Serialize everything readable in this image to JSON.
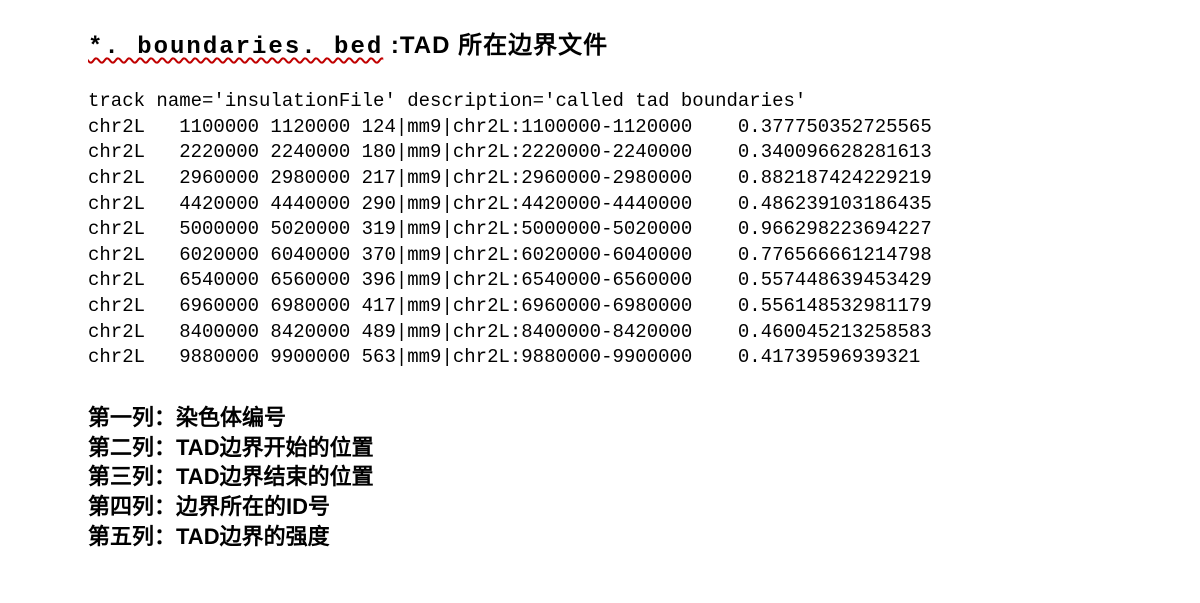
{
  "heading": {
    "filename": "*. boundaries. bed",
    "separator": " :",
    "desc": "TAD 所在边界文件"
  },
  "bed": {
    "track_line": "track name='insulationFile' description='called tad boundaries'",
    "rows": [
      {
        "chrom": "chr2L",
        "start": "1100000",
        "end": "1120000",
        "id": "124|mm9|chr2L:1100000-1120000",
        "score": "0.377750352725565"
      },
      {
        "chrom": "chr2L",
        "start": "2220000",
        "end": "2240000",
        "id": "180|mm9|chr2L:2220000-2240000",
        "score": "0.340096628281613"
      },
      {
        "chrom": "chr2L",
        "start": "2960000",
        "end": "2980000",
        "id": "217|mm9|chr2L:2960000-2980000",
        "score": "0.882187424229219"
      },
      {
        "chrom": "chr2L",
        "start": "4420000",
        "end": "4440000",
        "id": "290|mm9|chr2L:4420000-4440000",
        "score": "0.486239103186435"
      },
      {
        "chrom": "chr2L",
        "start": "5000000",
        "end": "5020000",
        "id": "319|mm9|chr2L:5000000-5020000",
        "score": "0.966298223694227"
      },
      {
        "chrom": "chr2L",
        "start": "6020000",
        "end": "6040000",
        "id": "370|mm9|chr2L:6020000-6040000",
        "score": "0.776566661214798"
      },
      {
        "chrom": "chr2L",
        "start": "6540000",
        "end": "6560000",
        "id": "396|mm9|chr2L:6540000-6560000",
        "score": "0.557448639453429"
      },
      {
        "chrom": "chr2L",
        "start": "6960000",
        "end": "6980000",
        "id": "417|mm9|chr2L:6960000-6980000",
        "score": "0.556148532981179"
      },
      {
        "chrom": "chr2L",
        "start": "8400000",
        "end": "8420000",
        "id": "489|mm9|chr2L:8400000-8420000",
        "score": "0.460045213258583"
      },
      {
        "chrom": "chr2L",
        "start": "9880000",
        "end": "9900000",
        "id": "563|mm9|chr2L:9880000-9900000",
        "score": "0.41739596939321"
      }
    ]
  },
  "legend": {
    "col1": "第一列：染色体编号",
    "col2": "第二列：TAD边界开始的位置",
    "col3": "第三列：TAD边界结束的位置",
    "col4": "第四列：边界所在的ID号",
    "col5": "第五列：TAD边界的强度"
  }
}
